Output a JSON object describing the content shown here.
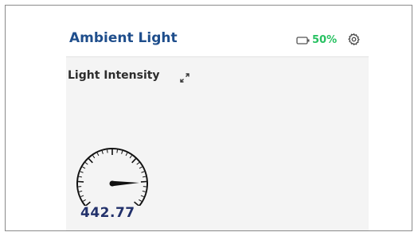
{
  "header": {
    "title": "Ambient Light",
    "battery": {
      "icon": "battery-icon",
      "value": "50%",
      "color": "#27c161"
    },
    "settings_icon": "gear-icon"
  },
  "widget": {
    "title": "Light Intensity",
    "expand_icon": "expand-icon",
    "gauge": {
      "value": "442.77",
      "needle_fraction": 0.84
    }
  },
  "colors": {
    "title": "#1f4e8c",
    "value": "#22316b",
    "battery": "#27c161",
    "card_background": "#f4f4f4"
  }
}
